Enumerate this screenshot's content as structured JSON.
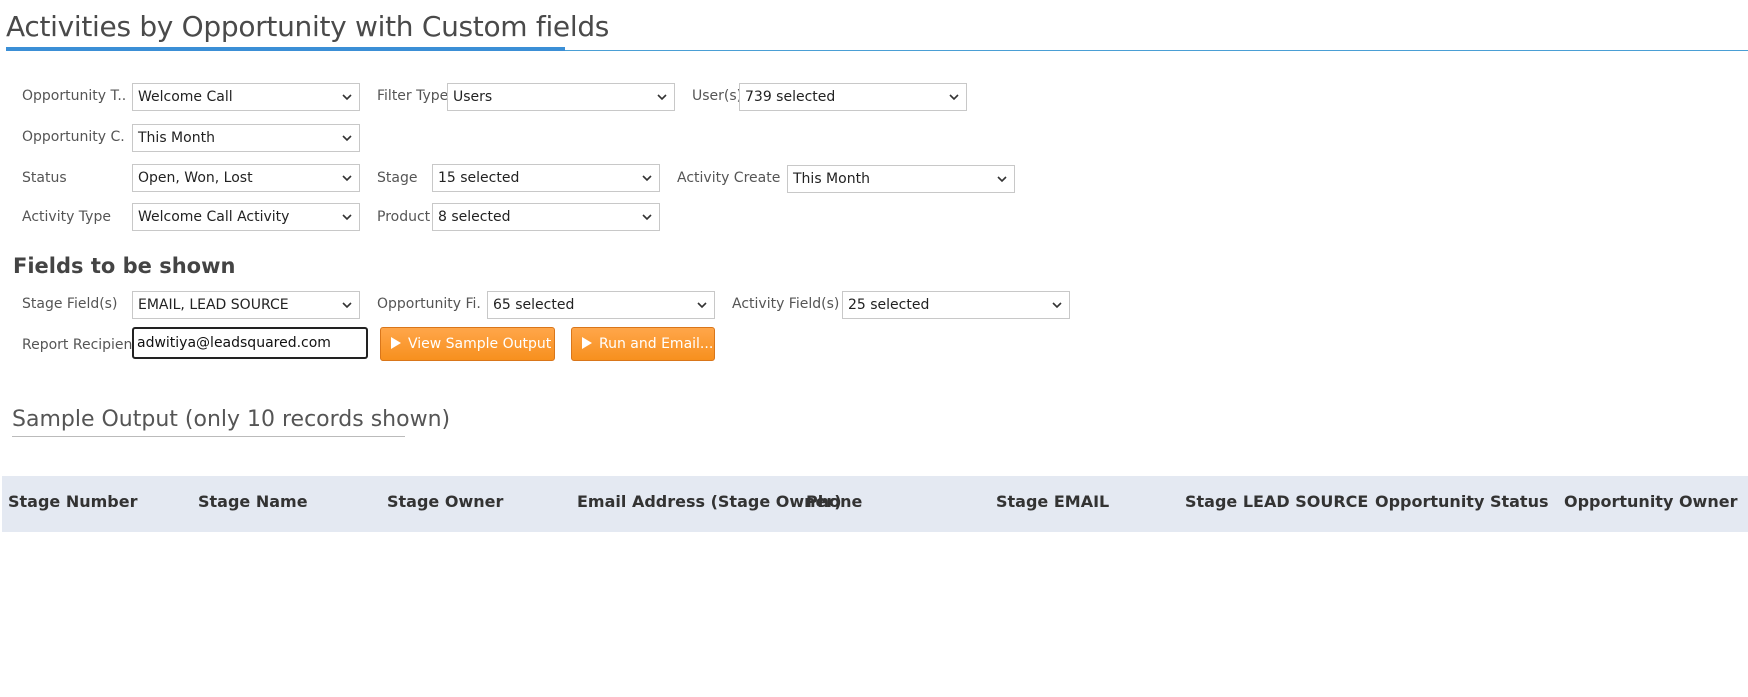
{
  "page": {
    "title": "Activities by Opportunity with Custom fields"
  },
  "filters": {
    "opportunity_type": {
      "label": "Opportunity T...",
      "value": "Welcome Call"
    },
    "filter_type": {
      "label": "Filter Type",
      "value": "Users"
    },
    "users": {
      "label": "User(s)",
      "value": "739 selected"
    },
    "opportunity_created": {
      "label": "Opportunity C...",
      "value": "This Month"
    },
    "status": {
      "label": "Status",
      "value": "Open, Won, Lost"
    },
    "stage": {
      "label": "Stage",
      "value": "15 selected"
    },
    "activity_created": {
      "label": "Activity Create...",
      "value": "This Month"
    },
    "activity_type": {
      "label": "Activity Type",
      "value": "Welcome Call Activity"
    },
    "product": {
      "label": "Product",
      "value": "8 selected"
    }
  },
  "fields_section": {
    "heading": "Fields to be shown",
    "stage_fields": {
      "label": "Stage Field(s)",
      "value": "EMAIL, LEAD SOURCE"
    },
    "opportunity_fields": {
      "label": "Opportunity Fi...",
      "value": "65 selected"
    },
    "activity_fields": {
      "label": "Activity Field(s)",
      "value": "25 selected"
    },
    "report_recipient": {
      "label": "Report Recipient",
      "value": "adwitiya@leadsquared.com"
    }
  },
  "buttons": {
    "view_sample": "View Sample Output",
    "run_email": "Run and Email..."
  },
  "sample_output": {
    "title": "Sample Output (only 10 records shown)",
    "columns": [
      "Stage Number",
      "Stage Name",
      "Stage Owner",
      "Email Address (Stage Owner)",
      "Phone",
      "Stage EMAIL",
      "Stage LEAD SOURCE",
      "Opportunity Status",
      "Opportunity Owner"
    ]
  },
  "colors": {
    "accent": "#3b8fd6",
    "button": "#f7901e",
    "table_header_bg": "#e4e9f2"
  },
  "icons": {
    "dropdown": "chevron-down-icon",
    "button": "play-icon"
  }
}
